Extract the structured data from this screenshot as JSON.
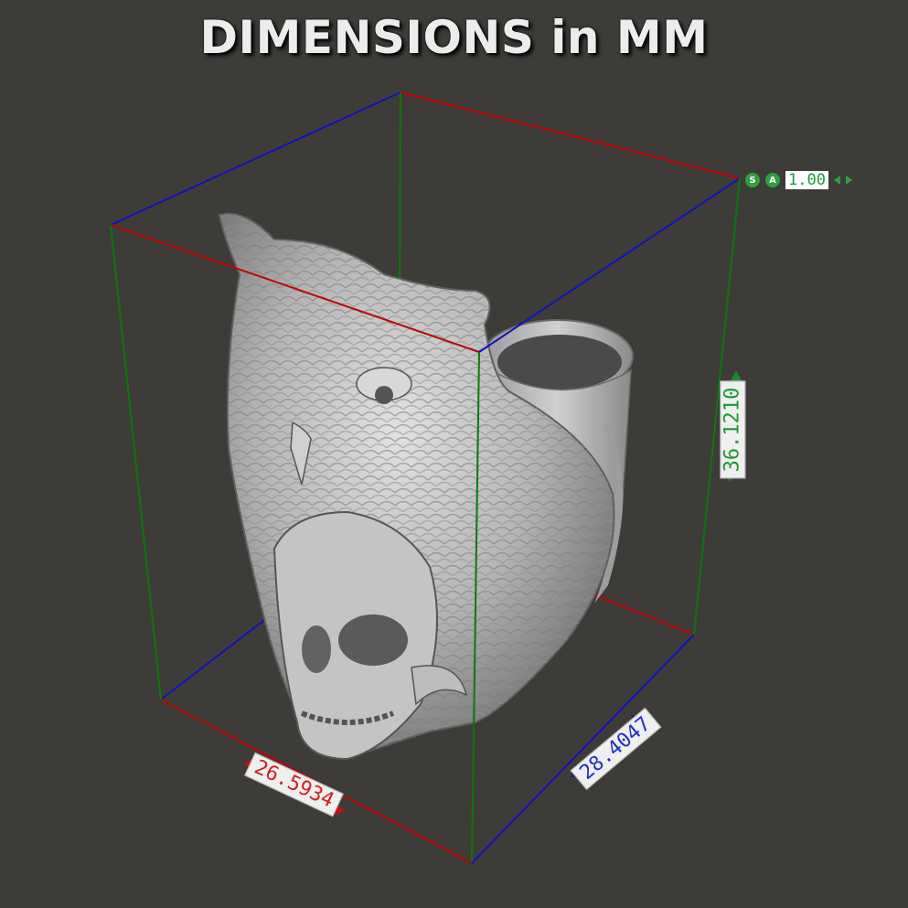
{
  "title": "DIMENSIONS in MM",
  "dimensions": {
    "width_label": "26.5934",
    "depth_label": "28.4047",
    "height_label": "36.1210"
  },
  "widget": {
    "s_button": "S",
    "a_button": "A",
    "scale_value": "1.00"
  },
  "colors": {
    "background": "#3e3c39",
    "x_axis": "#c00000",
    "y_axis": "#1010c0",
    "z_axis": "#0a7a0a",
    "model": "#b8b8b8"
  },
  "icons": [
    "scale-left-arrow-icon",
    "scale-right-arrow-icon",
    "dimension-arrow-icon"
  ]
}
